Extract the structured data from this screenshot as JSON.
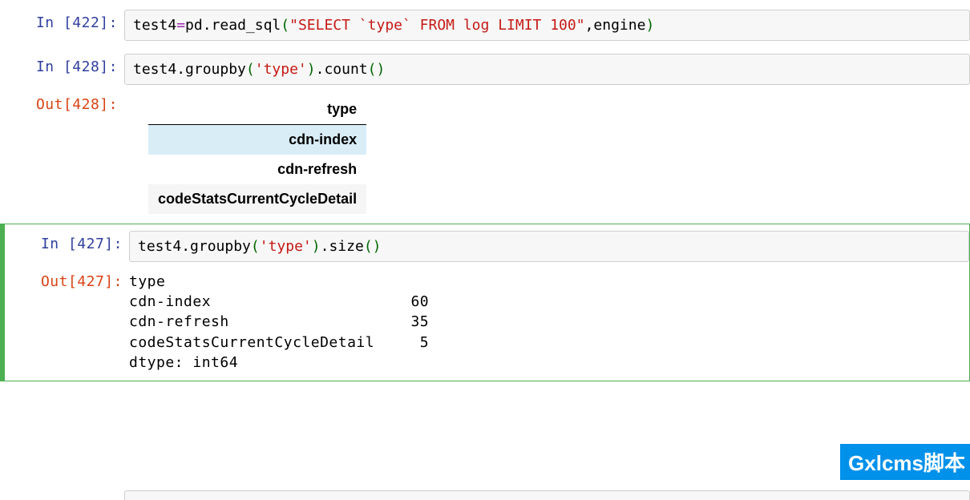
{
  "cells": {
    "c0": {
      "in_prompt": "In [422]:",
      "code": {
        "var": "test4",
        "assign": "=",
        "obj": "pd",
        "dot1": ".",
        "method": "read_sql",
        "lparen": "(",
        "str": "\"SELECT `type` FROM log LIMIT 100\"",
        "comma": ",",
        "arg2": "engine",
        "rparen": ")"
      }
    },
    "c1": {
      "in_prompt": "In [428]:",
      "out_prompt": "Out[428]:",
      "code": {
        "var": "test4",
        "dot1": ".",
        "m1": "groupby",
        "l1": "(",
        "str": "'type'",
        "r1": ")",
        "dot2": ".",
        "m2": "count",
        "l2": "(",
        "r2": ")"
      },
      "table": {
        "header": "type",
        "rows": [
          "cdn-index",
          "cdn-refresh",
          "codeStatsCurrentCycleDetail"
        ]
      }
    },
    "c2": {
      "in_prompt": "In [427]:",
      "out_prompt": "Out[427]:",
      "code": {
        "var": "test4",
        "dot1": ".",
        "m1": "groupby",
        "l1": "(",
        "str": "'type'",
        "r1": ")",
        "dot2": ".",
        "m2": "size",
        "l2": "(",
        "r2": ")"
      },
      "output": "type\ncdn-index                      60\ncdn-refresh                    35\ncodeStatsCurrentCycleDetail     5\ndtype: int64"
    }
  },
  "chart_data": {
    "type": "table",
    "title": "groupby('type').size()",
    "categories": [
      "cdn-index",
      "cdn-refresh",
      "codeStatsCurrentCycleDetail"
    ],
    "values": [
      60,
      35,
      5
    ],
    "dtype": "int64"
  },
  "watermark": "Gxlcms脚本"
}
